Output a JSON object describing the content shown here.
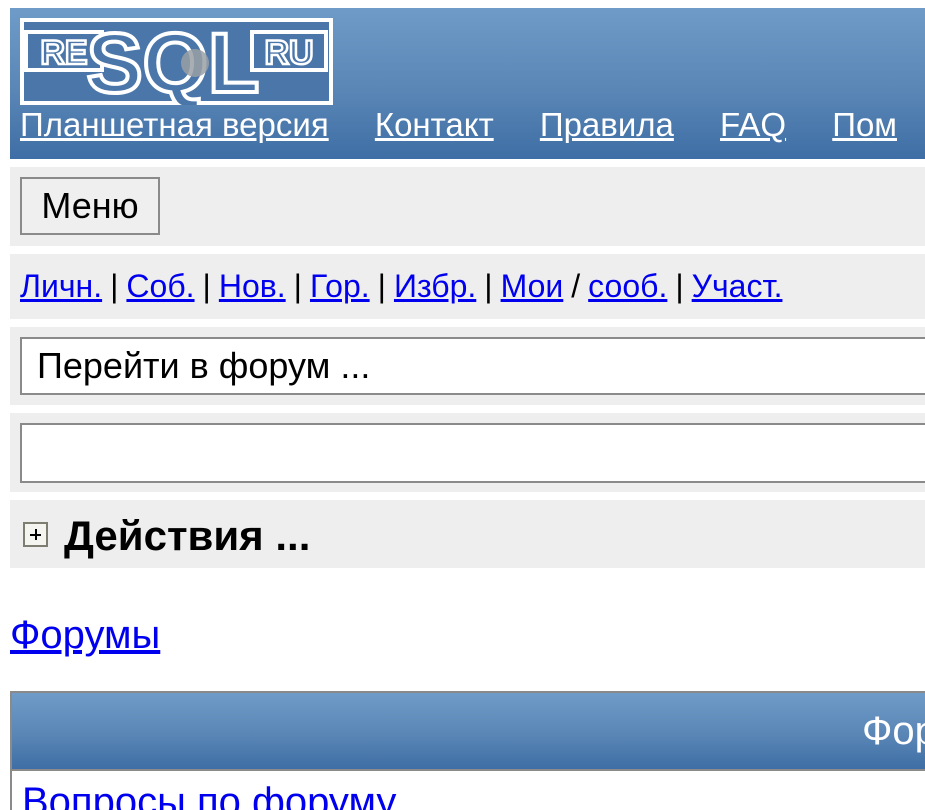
{
  "header": {
    "logo": {
      "left": "RE",
      "middle": "SQL",
      "right": "RU"
    },
    "links": [
      "Планшетная версия",
      "Контакт",
      "Правила",
      "FAQ",
      "Пом"
    ]
  },
  "menu": {
    "button_label": "Меню"
  },
  "quicklinks": {
    "items": [
      {
        "label": "Личн."
      },
      {
        "label": "Соб."
      },
      {
        "label": "Нов."
      },
      {
        "label": "Гор."
      },
      {
        "label": "Избр."
      },
      {
        "label": "Мои"
      },
      {
        "label": "сооб."
      },
      {
        "label": "Участ."
      }
    ],
    "separators": [
      "|",
      "|",
      "|",
      "|",
      "|",
      "/",
      "|"
    ]
  },
  "forum_select": {
    "value": "Перейти в форум ..."
  },
  "search": {
    "value": ""
  },
  "actions": {
    "title": "Действия ..."
  },
  "breadcrumb": {
    "forums_link": "Форумы"
  },
  "table": {
    "header_label": "Фор",
    "rows": [
      {
        "label": "Вопросы по форуму"
      }
    ]
  },
  "colors": {
    "header_gradient_top": "#6f9bc8",
    "header_gradient_bottom": "#3e6ea5",
    "bar_background": "#eeeeee",
    "link": "#0000ee"
  }
}
